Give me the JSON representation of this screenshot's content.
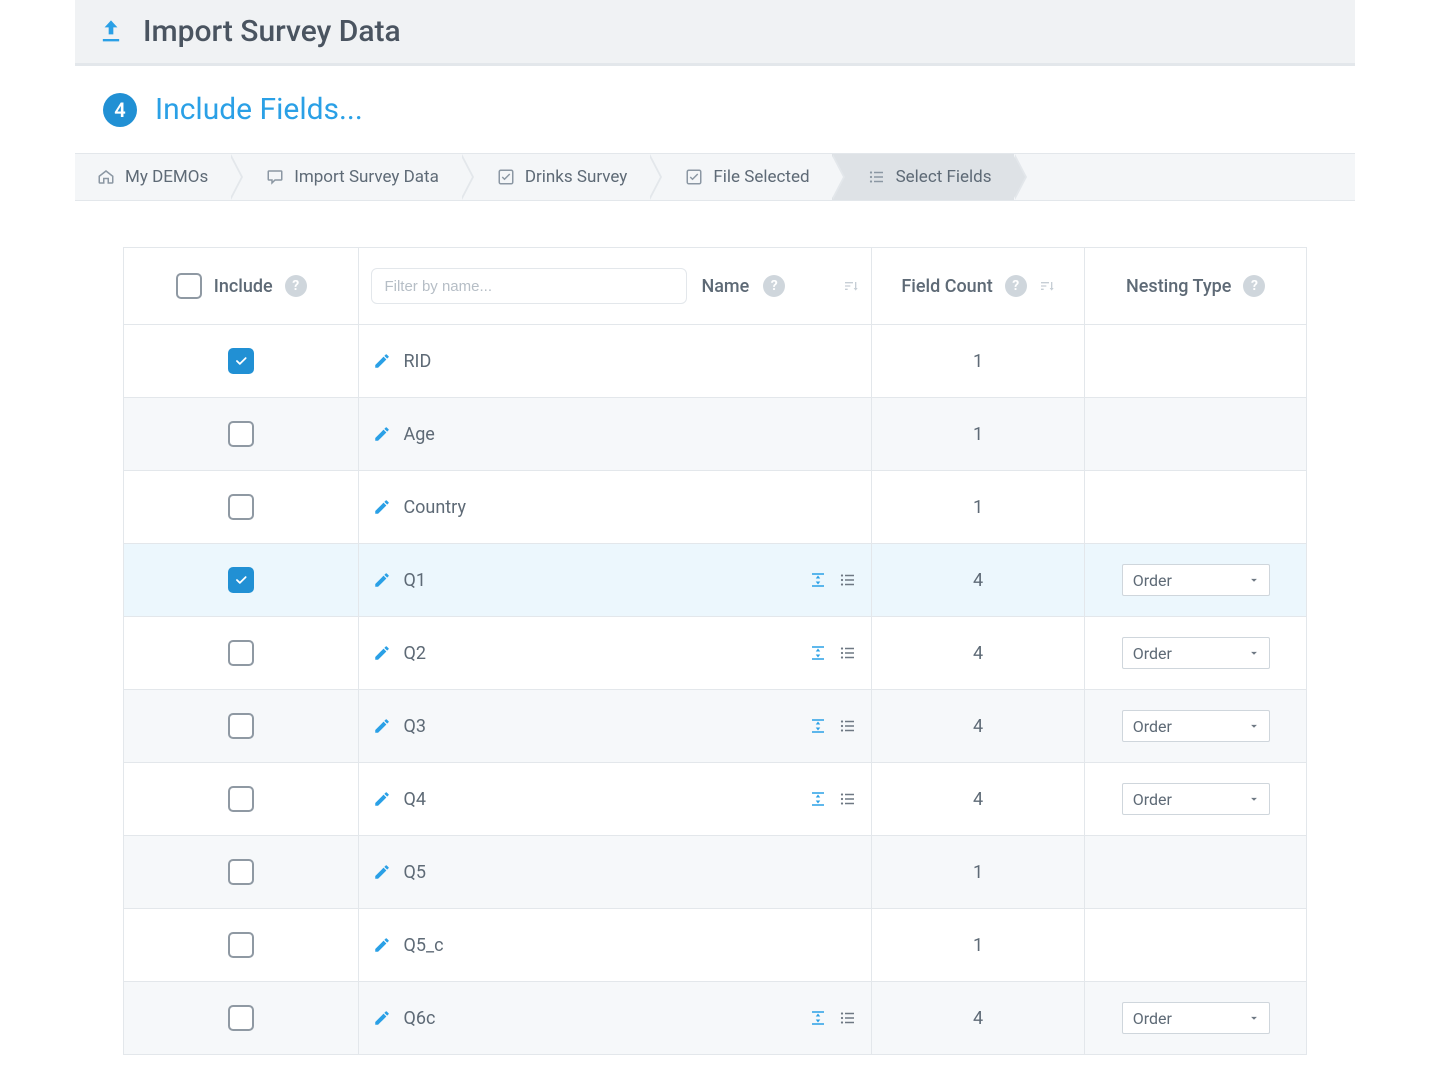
{
  "header": {
    "title": "Import Survey Data"
  },
  "section": {
    "step": "4",
    "title": "Include Fields..."
  },
  "breadcrumbs": [
    {
      "icon": "home",
      "label": "My DEMOs",
      "active": false
    },
    {
      "icon": "chat",
      "label": "Import Survey Data",
      "active": false
    },
    {
      "icon": "check",
      "label": "Drinks Survey",
      "active": false
    },
    {
      "icon": "check",
      "label": "File Selected",
      "active": false
    },
    {
      "icon": "list",
      "label": "Select Fields",
      "active": true
    }
  ],
  "table": {
    "columns": {
      "include": "Include",
      "name": "Name",
      "field_count": "Field Count",
      "nesting_type": "Nesting Type"
    },
    "filter_placeholder": "Filter by name...",
    "rows": [
      {
        "checked": true,
        "name": "RID",
        "count": "1",
        "nesting": null,
        "icons": false,
        "selected": false
      },
      {
        "checked": false,
        "name": "Age",
        "count": "1",
        "nesting": null,
        "icons": false,
        "selected": false
      },
      {
        "checked": false,
        "name": "Country",
        "count": "1",
        "nesting": null,
        "icons": false,
        "selected": false
      },
      {
        "checked": true,
        "name": "Q1",
        "count": "4",
        "nesting": "Order",
        "icons": true,
        "selected": true
      },
      {
        "checked": false,
        "name": "Q2",
        "count": "4",
        "nesting": "Order",
        "icons": true,
        "selected": false
      },
      {
        "checked": false,
        "name": "Q3",
        "count": "4",
        "nesting": "Order",
        "icons": true,
        "selected": false
      },
      {
        "checked": false,
        "name": "Q4",
        "count": "4",
        "nesting": "Order",
        "icons": true,
        "selected": false
      },
      {
        "checked": false,
        "name": "Q5",
        "count": "1",
        "nesting": null,
        "icons": false,
        "selected": false
      },
      {
        "checked": false,
        "name": "Q5_c",
        "count": "1",
        "nesting": null,
        "icons": false,
        "selected": false
      },
      {
        "checked": false,
        "name": "Q6c",
        "count": "4",
        "nesting": "Order",
        "icons": true,
        "selected": false
      }
    ]
  }
}
